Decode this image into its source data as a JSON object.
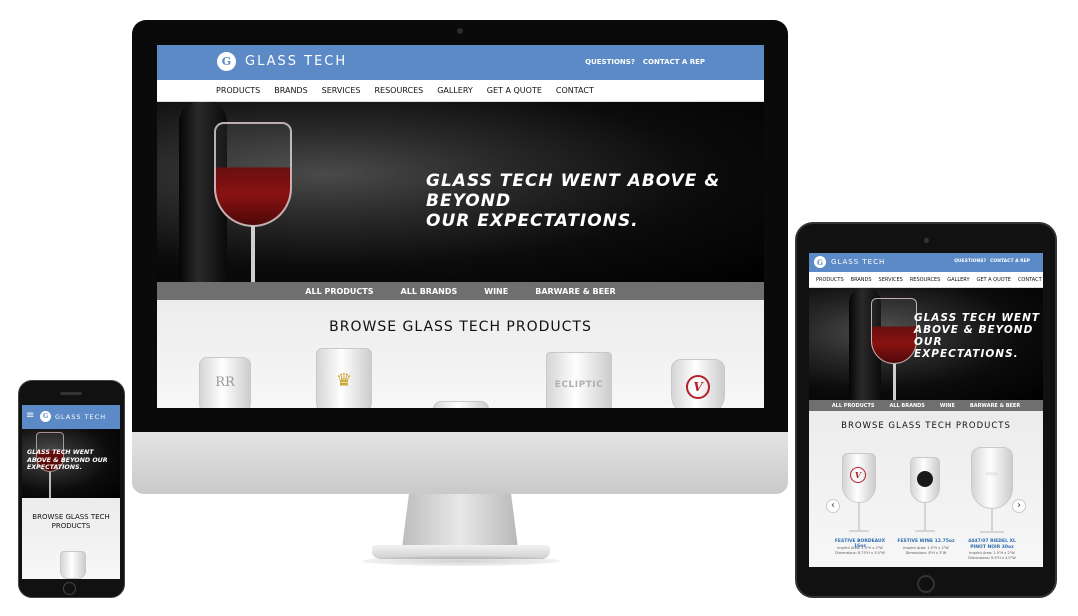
{
  "brand": {
    "name": "GLASS TECH",
    "accent": "#5b8ac6"
  },
  "header": {
    "questions": "QUESTIONS?",
    "contact_rep": "CONTACT A REP"
  },
  "nav": [
    "PRODUCTS",
    "BRANDS",
    "SERVICES",
    "RESOURCES",
    "GALLERY",
    "GET A QUOTE",
    "CONTACT"
  ],
  "hero": {
    "line1": "GLASS TECH WENT ABOVE & BEYOND",
    "line2": "OUR EXPECTATIONS.",
    "tablet_line1": "GLASS TECH WENT",
    "tablet_line2": "ABOVE & BEYOND",
    "tablet_line3": "OUR EXPECTATIONS.",
    "phone_line1": "GLASS TECH WENT",
    "phone_line2": "ABOVE & BEYOND OUR",
    "phone_line3": "EXPECTATIONS."
  },
  "subnav": [
    "ALL PRODUCTS",
    "ALL BRANDS",
    "WINE",
    "BARWARE & BEER"
  ],
  "browse": {
    "title": "BROWSE GLASS TECH PRODUCTS",
    "phone_line1": "BROWSE GLASS TECH",
    "phone_line2": "PRODUCTS"
  },
  "glass_logos": {
    "rr": "RR",
    "crown": "♛",
    "ecliptic": "ECLIPTIC",
    "v": "V"
  },
  "tablet_products": [
    {
      "name": "FESTIVE BORDEAUX 16oz",
      "line1": "Imprint Area: 1.5\"H x 2\"W",
      "line2": "Dimensions: 8.75\"H x 3.5\"W"
    },
    {
      "name": "FESTIVE WINE 12.75oz",
      "line1": "Imprint Area: 1.5\"H x 2\"W",
      "line2": "Dimensions: 8\"H x 3\"W"
    },
    {
      "name": "4447/07 RIEDEL XL PINOT NOIR 30oz",
      "line1": "Imprint Area: 1.5\"H x 2\"W",
      "line2": "Dimensions: 9.5\"H x 4.5\"W"
    }
  ],
  "carousel": {
    "prev": "‹",
    "next": "›"
  },
  "phone_menu": "≡"
}
